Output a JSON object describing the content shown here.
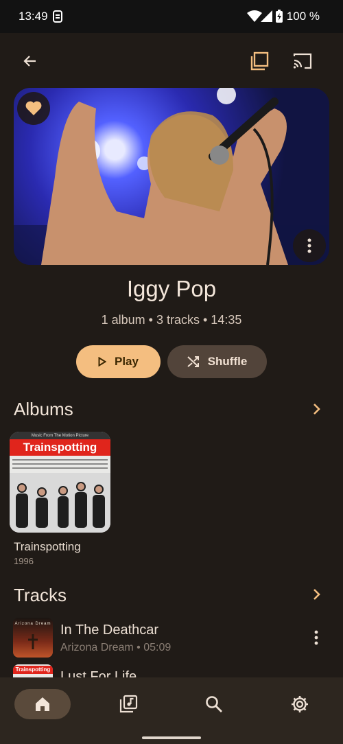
{
  "status": {
    "time": "13:49",
    "battery": "100 %"
  },
  "artist": {
    "name": "Iggy Pop",
    "meta": "1 album • 3 tracks • 14:35"
  },
  "actions": {
    "play": "Play",
    "shuffle": "Shuffle"
  },
  "sections": {
    "albums": "Albums",
    "tracks": "Tracks"
  },
  "albums": [
    {
      "title": "Trainspotting",
      "year": "1996",
      "cover_text": "Trainspotting",
      "cover_header": "Music From The Motion Picture"
    }
  ],
  "tracks": [
    {
      "title": "In The Deathcar",
      "subtitle": "Arizona Dream • 05:09",
      "cover_text": "Arizona Dream"
    },
    {
      "title": "Lust For Life",
      "subtitle": "",
      "cover_text": "Trainspotting"
    }
  ],
  "colors": {
    "background": "#201b17",
    "accent": "#f4be80",
    "secondary": "#52443a",
    "nav_active": "#5a4a3b"
  },
  "icons": [
    "back-arrow-icon",
    "queue-icon",
    "cast-icon",
    "heart-icon",
    "more-vert-icon",
    "play-icon",
    "shuffle-icon",
    "chevron-right-icon",
    "home-icon",
    "library-icon",
    "search-icon",
    "settings-icon"
  ]
}
